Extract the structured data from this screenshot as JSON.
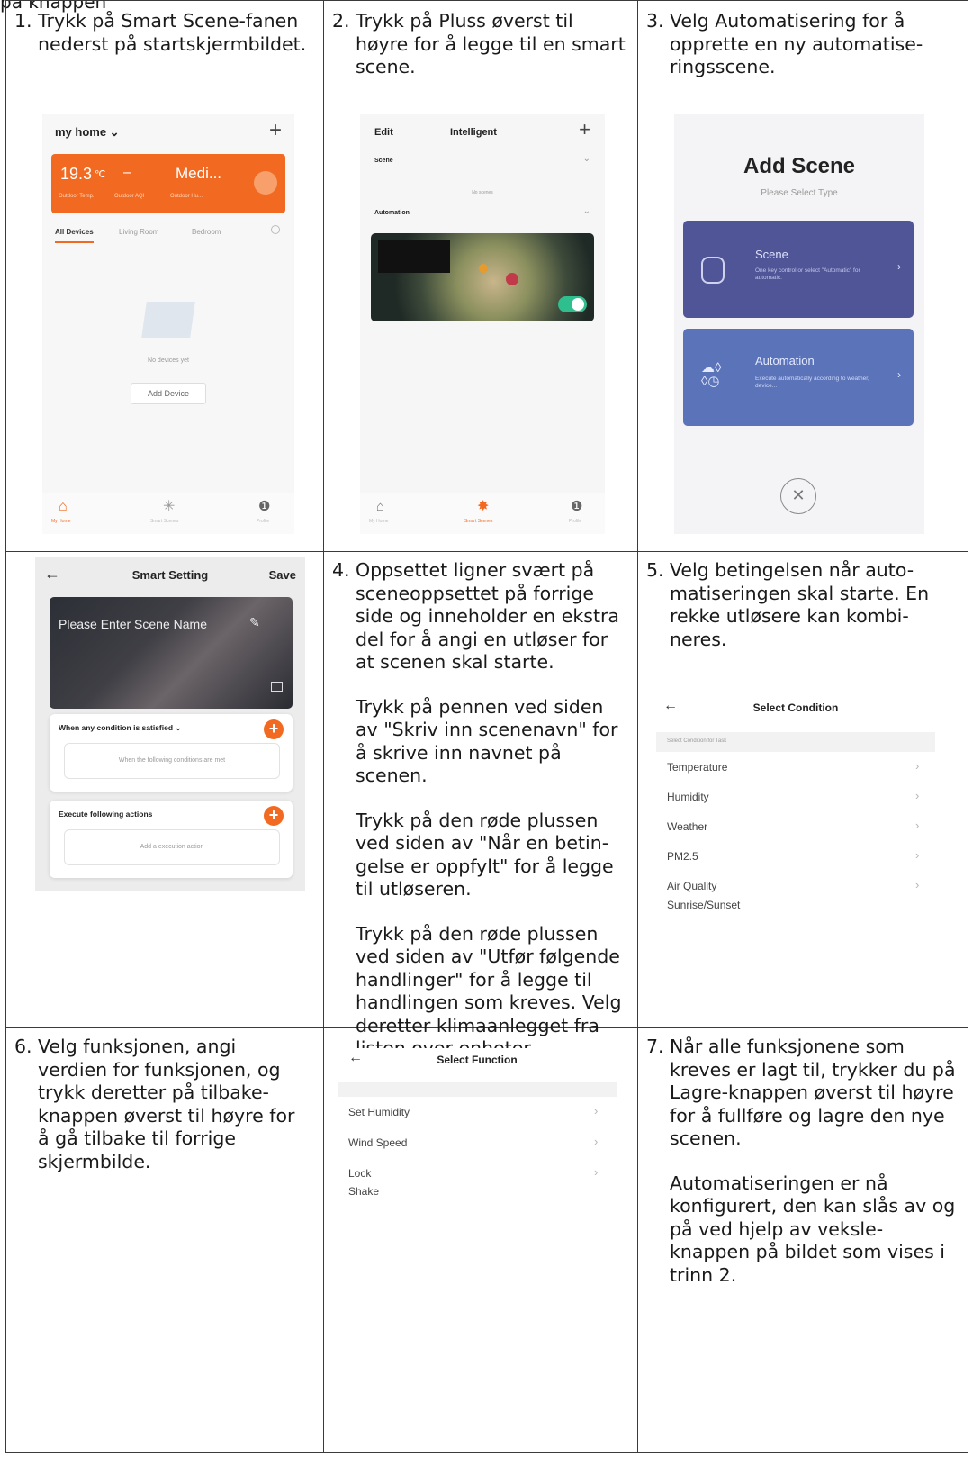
{
  "fragment": "på knappen",
  "steps": {
    "s1": {
      "num": "1.",
      "text": "Trykk på Smart Scene-fanen nederst på startskjermbildet."
    },
    "s2": {
      "num": "2.",
      "text": "Trykk på Pluss øverst til høyre for å legge til en smart scene."
    },
    "s3": {
      "num": "3.",
      "text": "Velg Automatisering for å opprette en ny automatise-ringsscene."
    },
    "s4": {
      "num": "4.",
      "text": "Oppsettet ligner svært på sceneoppsettet på forrige side og inneholder en ekstra del for å angi en utløser for at scenen skal starte.",
      "p2": "Trykk på pennen ved siden av \"Skriv inn scenenavn\" for å skrive inn navnet på scenen.",
      "p3": "Trykk på den røde plussen ved siden av \"Når en betin-gelse er oppfylt\" for å legge til utløseren.",
      "p4": "Trykk på den røde plussen ved siden av \"Utfør følgende handlinger\" for å legge til handlingen som kreves. Velg deretter klimaanlegget fra listen over enheter."
    },
    "s5": {
      "num": "5.",
      "text": "Velg betingelsen når auto-matiseringen skal starte. En rekke utløsere kan kombi-neres."
    },
    "s6": {
      "num": "6.",
      "text": "Velg funksjonen, angi verdien for funksjonen, og trykk deretter på tilbake-knappen øverst til høyre for å gå tilbake til forrige skjermbilde."
    },
    "s7": {
      "num": "7.",
      "text": "Når alle funksjonene som kreves er lagt til, trykker du på Lagre-knappen øverst til høyre for å fullføre og lagre den nye scenen.",
      "p2": "Automatiseringen er nå konfigurert, den kan slås av og på ved hjelp av veksle-knappen på bildet som vises i trinn 2."
    }
  },
  "screen1": {
    "home": "my home ⌄",
    "plus": "+",
    "temp": "19.3",
    "unit": "℃",
    "dash": "–",
    "medi": "Medi...",
    "sub1": "Outdoor Temp.",
    "sub2": "Outdoor AQI",
    "sub3": "Outdoor Hu...",
    "tabs": [
      "All Devices",
      "Living Room",
      "Bedroom"
    ],
    "empty": "No devices yet",
    "add": "Add Device",
    "nav": [
      "My Home",
      "Smart Scenes",
      "Profile"
    ]
  },
  "screen2": {
    "edit": "Edit",
    "title": "Intelligent",
    "plus": "+",
    "scene": "Scene",
    "noscene": "No scenes",
    "automation": "Automation",
    "nav": [
      "My Home",
      "Smart Scenes",
      "Profile"
    ]
  },
  "screen3": {
    "title": "Add Scene",
    "sub": "Please Select Type",
    "c1title": "Scene",
    "c1desc": "One key control or select \"Automatic\" for automatic.",
    "c2title": "Automation",
    "c2desc": "Execute automatically according to weather, device..."
  },
  "screen4": {
    "title": "Smart Setting",
    "save": "Save",
    "back": "←",
    "name": "Please Enter Scene Name",
    "cond": "When any condition is satisfied ⌄",
    "condbox": "When the following conditions are met",
    "exec": "Execute following actions",
    "execbox": "Add a execution action"
  },
  "screen5": {
    "back": "←",
    "title": "Select Condition",
    "hint": "Select Condition for Task",
    "items": [
      "Temperature",
      "Humidity",
      "Weather",
      "PM2.5",
      "Air Quality",
      "Sunrise/Sunset"
    ]
  },
  "screen6": {
    "back": "←",
    "title": "Select Function",
    "items": [
      "Set Humidity",
      "Wind Speed",
      "Lock",
      "Shake"
    ]
  },
  "colors": {
    "orange": "#f26a21",
    "sceneCard": "#4f5596",
    "autoCard": "#5b73b9",
    "toggle": "#2fbf8f"
  }
}
